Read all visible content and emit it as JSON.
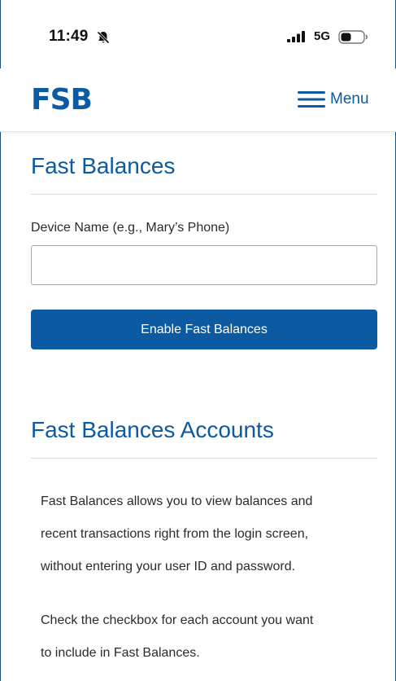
{
  "status_bar": {
    "time": "11:49",
    "network": "5G",
    "icons": [
      "bell-slash-icon",
      "signal-bars-icon",
      "battery-icon"
    ]
  },
  "header": {
    "logo_text": "FSB",
    "menu_label": "Menu",
    "menu_icon": "hamburger-icon"
  },
  "fast_balances": {
    "title": "Fast Balances",
    "device_label": "Device Name (e.g., Mary’s Phone)",
    "device_value": "",
    "enable_button_label": "Enable Fast Balances"
  },
  "accounts": {
    "title": "Fast Balances Accounts",
    "description_lines": [
      "Fast Balances allows you to view balances and",
      "recent transactions right from the login screen,",
      "without entering your user ID and password."
    ],
    "instruction_lines": [
      "Check the checkbox for each account you want",
      "to include in Fast Balances."
    ]
  },
  "colors": {
    "brand_blue": "#0b5aa2",
    "text": "#2b2b2b",
    "divider": "#dcdcdc"
  }
}
